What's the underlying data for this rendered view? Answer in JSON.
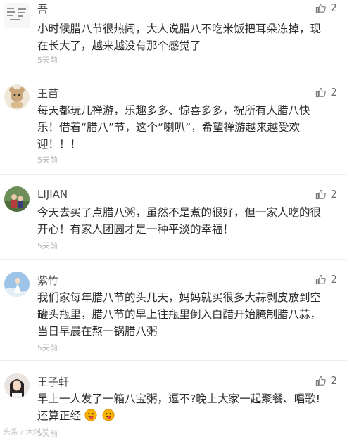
{
  "comments": [
    {
      "user": "吾",
      "likes": "2",
      "lines": [
        "小时候腊八节很热闹，大人说腊八不吃米饭把耳朵冻掉，现",
        "在长大了，越来越没有那个感觉了"
      ],
      "time": "5天前"
    },
    {
      "user": "王苗",
      "likes": "2",
      "lines": [
        "每天都玩儿禅游，乐趣多多、惊喜多多，祝所有人腊八快",
        "乐！借着“腊八”节，这个“喇叭”，希望禅游越来越受欢",
        "迎！！！"
      ],
      "time": "5天前"
    },
    {
      "user": "LIJIAN",
      "likes": "2",
      "lines": [
        "今天去买了点腊八粥，虽然不是煮的很好，但一家人吃的很",
        "开心！有家人团圆才是一种平淡的幸福！"
      ],
      "time": "5天前"
    },
    {
      "user": "紫竹",
      "likes": "2",
      "lines": [
        "我们家每年腊八节的头几天，妈妈就买很多大蒜剥皮放到空",
        "罐头瓶里，腊八节的早上往瓶里倒入白醋开始腌制腊八蒜，",
        "当日早晨在熬一锅腊八粥"
      ],
      "time": "5天前"
    },
    {
      "user": "王子軒",
      "likes": "2",
      "lines": [
        "早上一人发了一箱八宝粥，逗不?晚上大家一起聚餐、唱歌!",
        "还算正经"
      ],
      "time": "5天前"
    }
  ],
  "watermark": "头条 / 大风号",
  "icons": {
    "like": "thumbs-up-icon",
    "emoji": "tongue-out-emoji-icon"
  },
  "colors": {
    "text": "#2b2b2b",
    "username": "#4a4a4a",
    "time": "#b3b3b3",
    "separator": "#ececec"
  }
}
